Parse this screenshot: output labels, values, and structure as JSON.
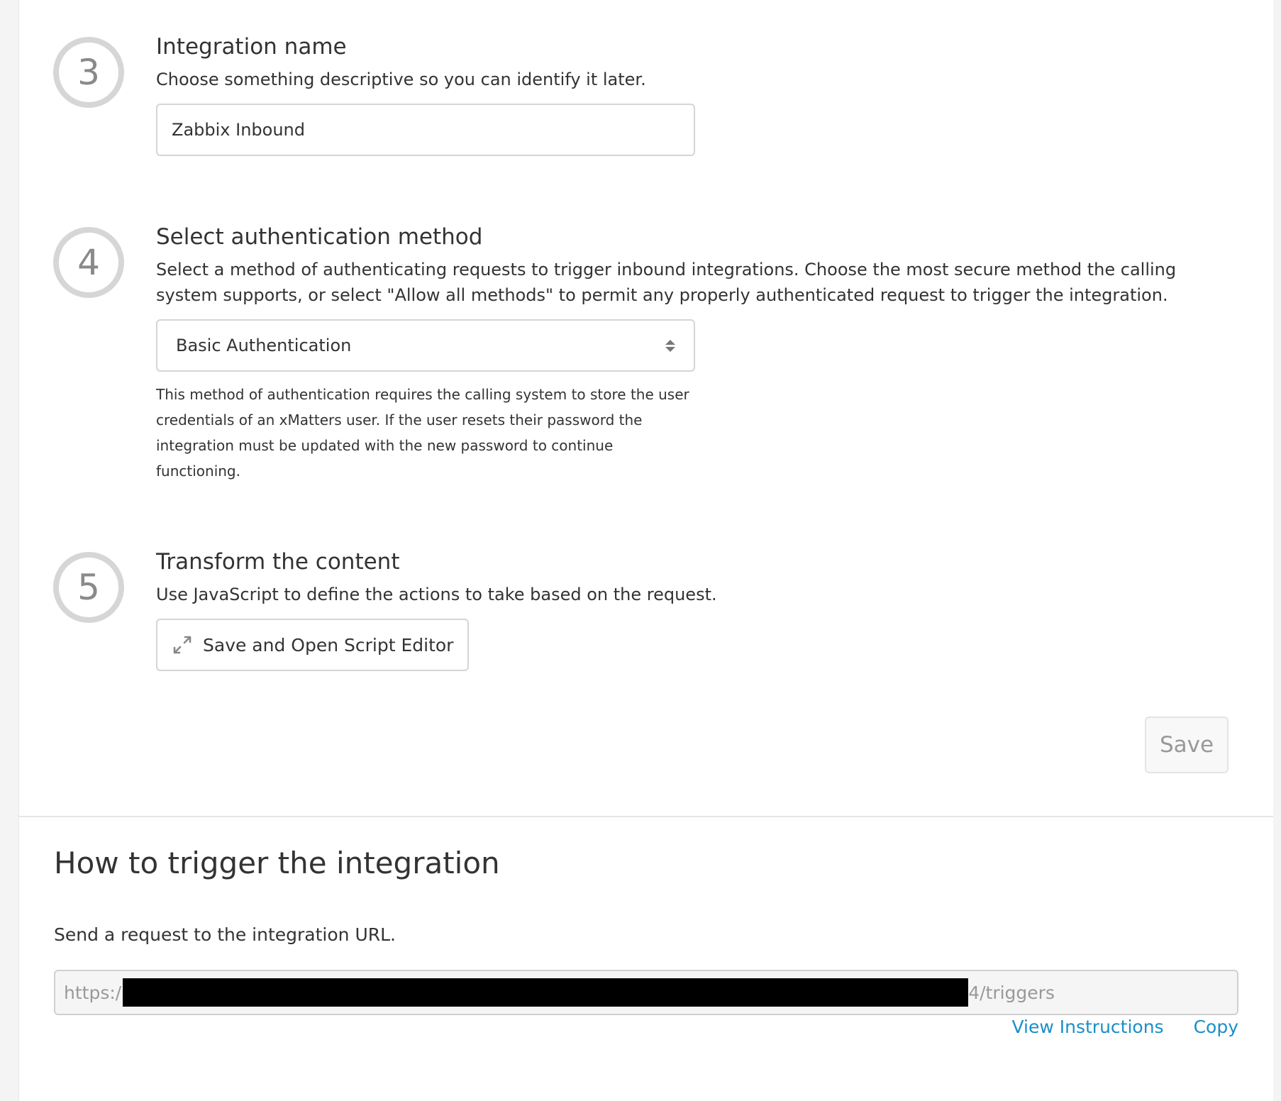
{
  "steps": [
    {
      "number": "3",
      "title": "Integration name",
      "description": "Choose something descriptive so you can identify it later.",
      "input_value": "Zabbix Inbound"
    },
    {
      "number": "4",
      "title": "Select authentication method",
      "description": "Select a method of authenticating requests to trigger inbound integrations. Choose the most secure method the calling system supports, or select \"Allow all methods\" to permit any properly authenticated request to trigger the integration.",
      "select_value": "Basic Authentication",
      "help_text": "This method of authentication requires the calling system to store the user credentials of an xMatters user. If the user resets their password the integration must be updated with the new password to continue functioning."
    },
    {
      "number": "5",
      "title": "Transform the content",
      "description": "Use JavaScript to define the actions to take based on the request.",
      "button_label": "Save and Open Script Editor",
      "button_icon": "expand-icon"
    }
  ],
  "save_label": "Save",
  "trigger": {
    "title": "How to trigger the integration",
    "description": "Send a request to the integration URL.",
    "url_prefix": "https:/",
    "url_suffix": "4/triggers",
    "view_instructions_label": "View Instructions",
    "copy_label": "Copy"
  },
  "colors": {
    "link": "#1b8ec7",
    "step_circle": "#d6d6d6",
    "step_number": "#8a8a8a"
  }
}
